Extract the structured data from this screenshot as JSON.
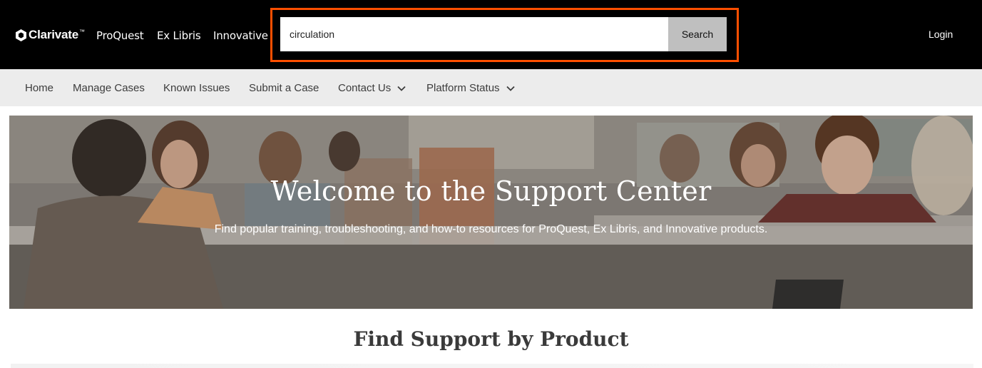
{
  "header": {
    "brand": {
      "logo_text": "Clarivate",
      "logo_mark": "™",
      "links": [
        "ProQuest",
        "Ex Libris",
        "Innovative"
      ]
    },
    "search": {
      "value": "circulation",
      "button_label": "Search"
    },
    "login_label": "Login",
    "colors": {
      "background": "#000000",
      "search_highlight": "#ff4f00",
      "search_button": "#bfbfbf"
    }
  },
  "nav": {
    "items": [
      {
        "label": "Home",
        "has_dropdown": false
      },
      {
        "label": "Manage Cases",
        "has_dropdown": false
      },
      {
        "label": "Known Issues",
        "has_dropdown": false
      },
      {
        "label": "Submit a Case",
        "has_dropdown": false
      },
      {
        "label": "Contact Us",
        "has_dropdown": true
      },
      {
        "label": "Platform Status",
        "has_dropdown": true
      }
    ]
  },
  "hero": {
    "title": "Welcome to the Support Center",
    "subtitle": "Find popular training, troubleshooting, and how-to resources for ProQuest, Ex Libris, and Innovative products."
  },
  "main": {
    "section_title": "Find Support by Product"
  }
}
